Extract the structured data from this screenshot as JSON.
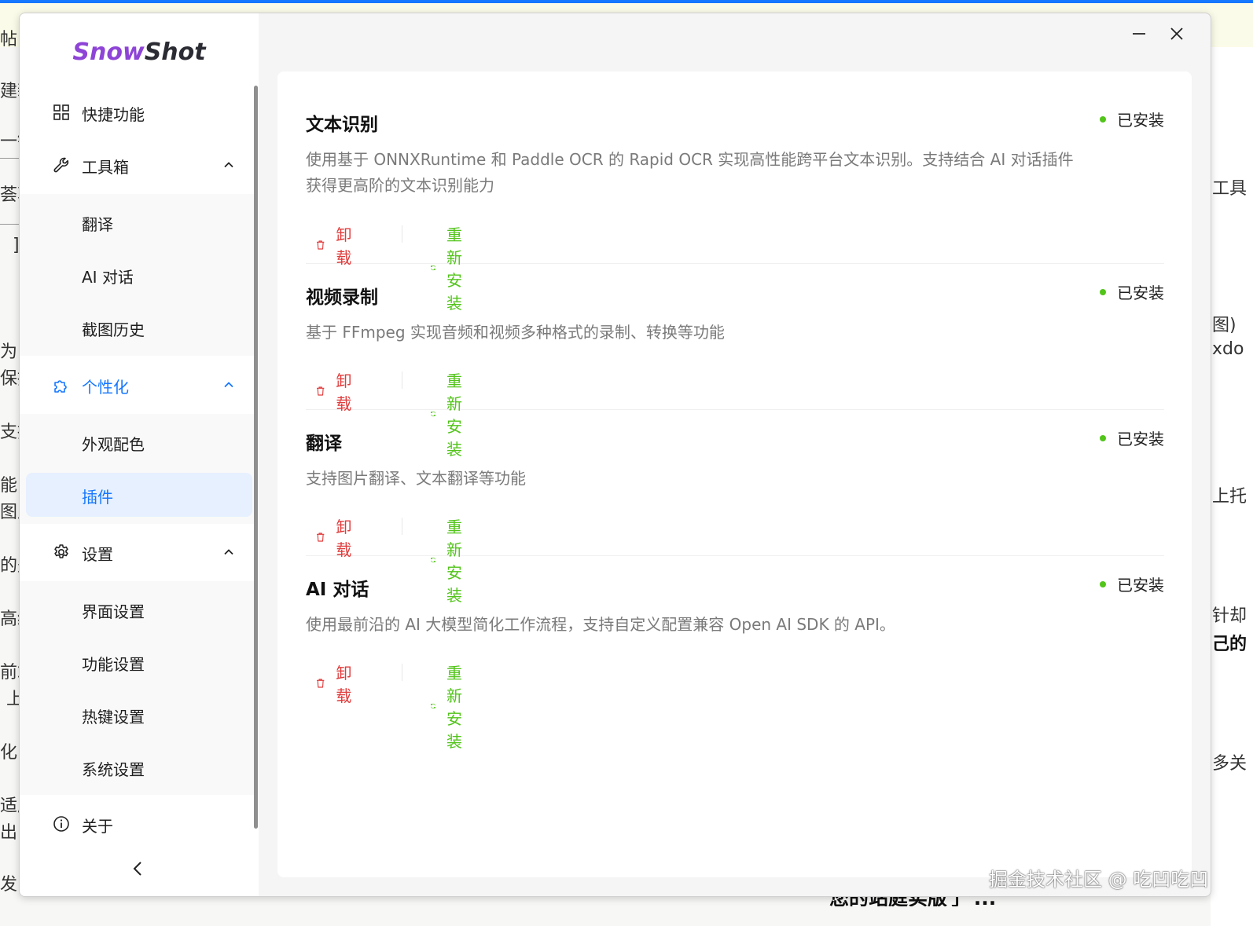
{
  "background": {
    "left_fragments": [
      "帖",
      "建新",
      "一键",
      "荟萃",
      "]",
      "为",
      "保持",
      "支持",
      "能以",
      "图片",
      "的是",
      "高级",
      "前端",
      "上",
      "化",
      "适应",
      "出了",
      "发"
    ],
    "right_fragments": [
      "工具",
      "图)",
      "xdo",
      "上托",
      "针却",
      "己的",
      "多关"
    ],
    "bottom_text": "您的站庭实版了 ...",
    "watermark": "掘金技术社区 @ 吃凹吃凹"
  },
  "app": {
    "logo_part1": "Snow",
    "logo_part2": "Shot",
    "titlebar": {
      "minimize_icon": "minimize-icon",
      "close_icon": "close-icon"
    },
    "sidebar": {
      "quick": {
        "label": "快捷功能",
        "icon": "grid-icon"
      },
      "toolbox": {
        "label": "工具箱",
        "icon": "wrench-icon",
        "items": [
          "翻译",
          "AI 对话",
          "截图历史"
        ]
      },
      "personalize": {
        "label": "个性化",
        "icon": "puzzle-icon",
        "items": [
          "外观配色",
          "插件"
        ],
        "selected": "插件"
      },
      "settings": {
        "label": "设置",
        "icon": "gear-icon",
        "items": [
          "界面设置",
          "功能设置",
          "热键设置",
          "系统设置"
        ]
      },
      "about": {
        "label": "关于",
        "icon": "info-icon"
      }
    },
    "plugins": [
      {
        "title": "文本识别",
        "status": "已安装",
        "desc": "使用基于 ONNXRuntime 和 Paddle OCR 的 Rapid OCR 实现高性能跨平台文本识别。支持结合 AI 对话插件获得更高阶的文本识别能力",
        "uninstall": "卸载",
        "reinstall": "重新安装"
      },
      {
        "title": "视频录制",
        "status": "已安装",
        "desc": "基于 FFmpeg 实现音频和视频多种格式的录制、转换等功能",
        "uninstall": "卸载",
        "reinstall": "重新安装"
      },
      {
        "title": "翻译",
        "status": "已安装",
        "desc": "支持图片翻译、文本翻译等功能",
        "uninstall": "卸载",
        "reinstall": "重新安装"
      },
      {
        "title": "AI 对话",
        "status": "已安装",
        "desc": "使用最前沿的 AI 大模型简化工作流程，支持自定义配置兼容 Open AI SDK 的 API。",
        "uninstall": "卸载",
        "reinstall": "重新安装"
      }
    ],
    "colors": {
      "accent": "#1677ff",
      "danger": "#e03c3c",
      "success": "#52c41a",
      "logo_purple": "#8e44d6"
    }
  }
}
